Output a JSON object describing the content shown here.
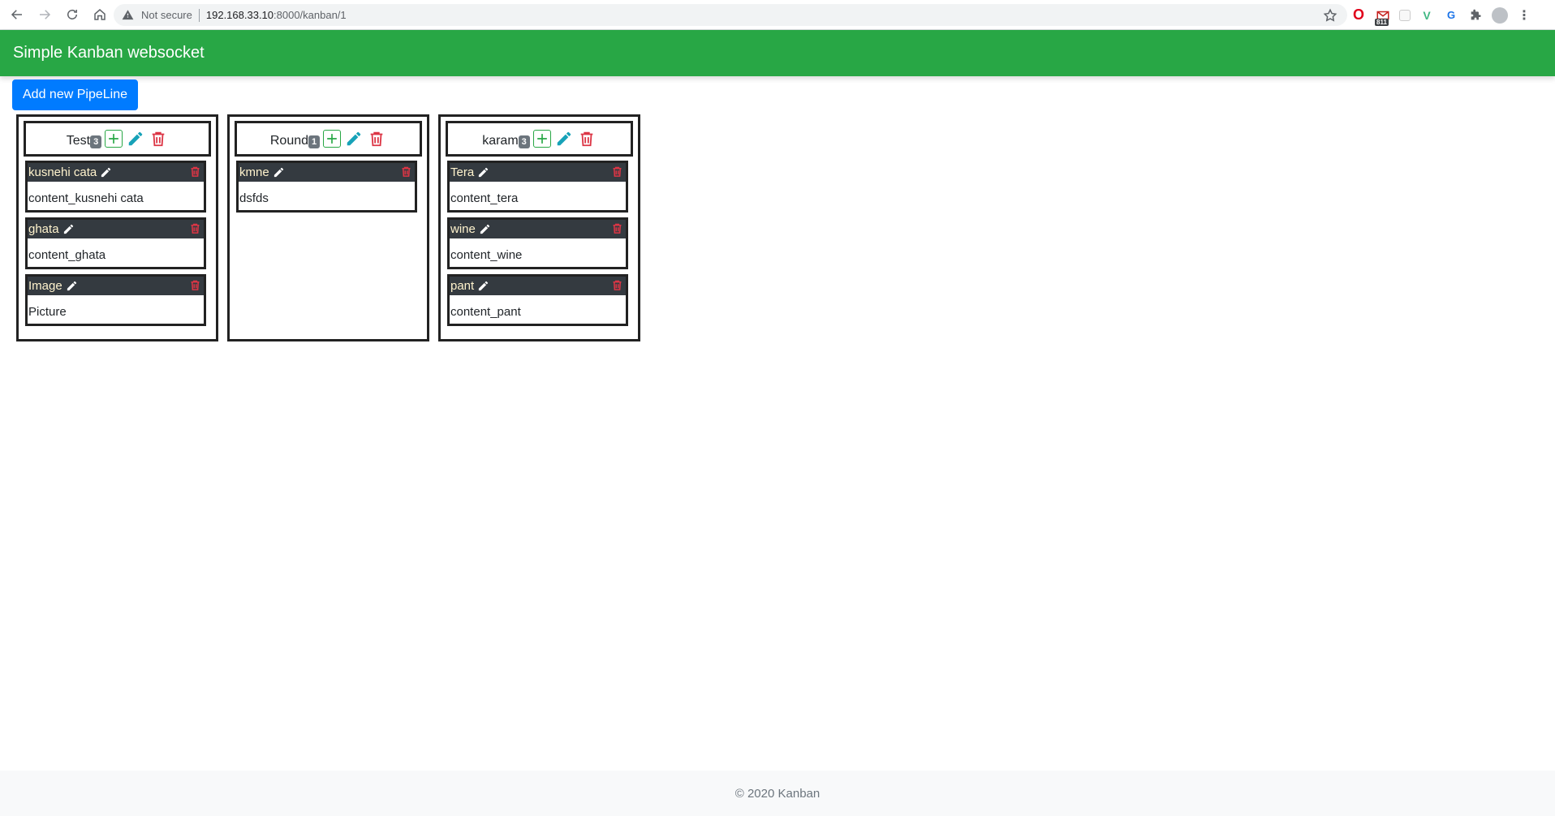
{
  "browser": {
    "not_secure": "Not secure",
    "url_host": "192.168.33.10",
    "url_path": ":8000/kanban/1",
    "mail_count": "811"
  },
  "app": {
    "brand": "Simple Kanban websocket",
    "add_pipeline_label": "Add new PipeLine",
    "footer": "© 2020 Kanban"
  },
  "colors": {
    "navbar": "#28a745",
    "primary": "#007bff",
    "card_header": "#343a40",
    "danger": "#dc3545",
    "info": "#17a2b8"
  },
  "pipelines": [
    {
      "title": "Test",
      "count": "3",
      "cards": [
        {
          "title": "kusnehi cata",
          "content": "content_kusnehi cata"
        },
        {
          "title": "ghata",
          "content": "content_ghata"
        },
        {
          "title": "Image",
          "content": "Picture"
        }
      ]
    },
    {
      "title": "Round",
      "count": "1",
      "cards": [
        {
          "title": "kmne",
          "content": "dsfds"
        }
      ]
    },
    {
      "title": "karam",
      "count": "3",
      "cards": [
        {
          "title": "Tera",
          "content": "content_tera"
        },
        {
          "title": "wine",
          "content": "content_wine"
        },
        {
          "title": "pant",
          "content": "content_pant"
        }
      ]
    }
  ]
}
